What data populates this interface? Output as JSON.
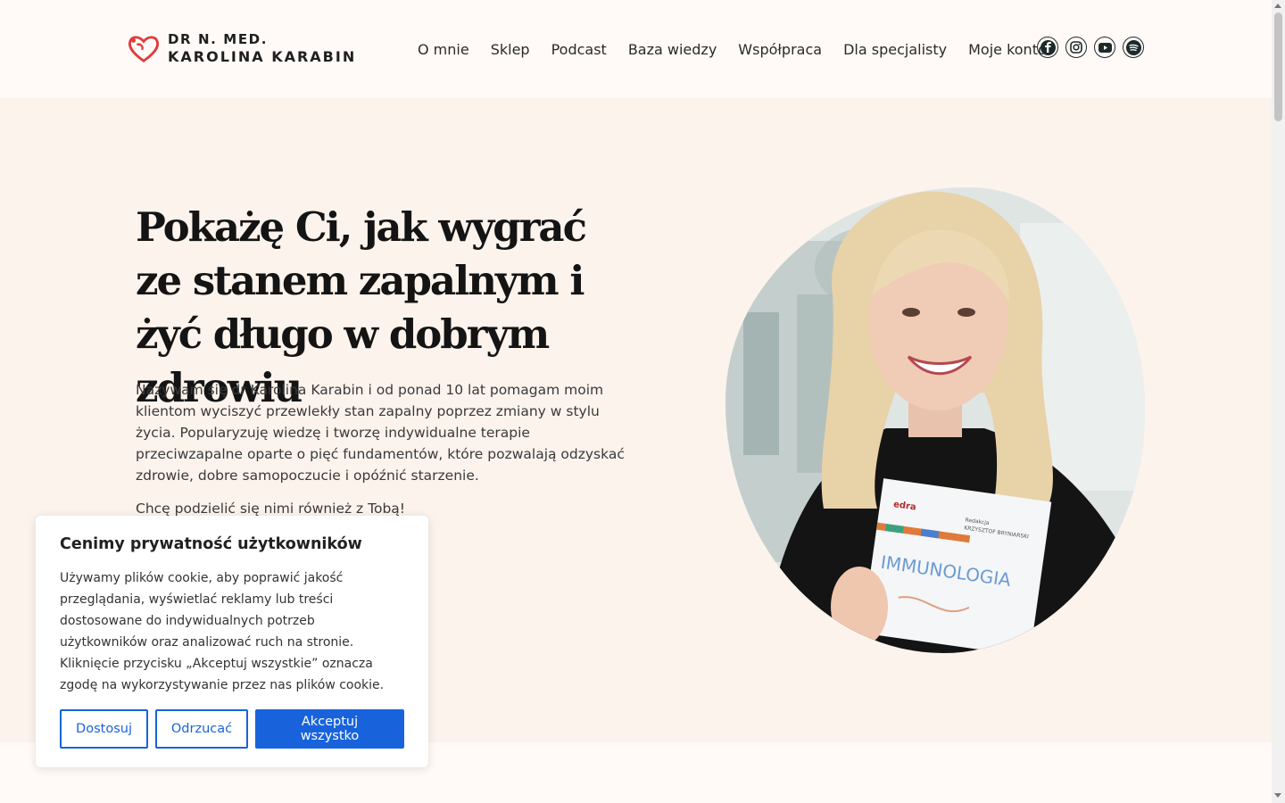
{
  "brand": {
    "line1": "DR N. MED.",
    "line2": "KAROLINA KARABIN",
    "accent_color": "#e23b3b"
  },
  "nav": {
    "items": [
      {
        "label": "O mnie"
      },
      {
        "label": "Sklep"
      },
      {
        "label": "Podcast"
      },
      {
        "label": "Baza wiedzy"
      },
      {
        "label": "Współpraca"
      },
      {
        "label": "Dla specjalisty"
      },
      {
        "label": "Moje konto"
      }
    ]
  },
  "socials": [
    {
      "icon": "facebook-icon"
    },
    {
      "icon": "instagram-icon"
    },
    {
      "icon": "youtube-icon"
    },
    {
      "icon": "spotify-icon"
    }
  ],
  "hero": {
    "title": "Pokażę Ci, jak wygrać ze stanem zapalnym i żyć długo w dobrym zdrowiu",
    "paragraph": "Nazywam się dr Karolina Karabin i od ponad 10 lat pomagam moim klientom wyciszyć przewlekły stan zapalny poprzez zmiany w stylu życia. Popularyzuję wiedzę i tworzę indywidualne terapie przeciwzapalne oparte o pięć fundamentów, które pozwalają odzyskać zdrowie, dobre samopoczucie i opóźnić starzenie.",
    "paragraph2": "Chcę podzielić się nimi również z Tobą!",
    "book_title": "IMMUNOLOGIA",
    "book_editor": "KRZYSZTOF BRYNIARSKI",
    "book_editor_label": "Redakcja"
  },
  "cookie": {
    "title": "Cenimy prywatność użytkowników",
    "text": "Używamy plików cookie, aby poprawić jakość przeglądania, wyświetlać reklamy lub treści dostosowane do indywidualnych potrzeb użytkowników oraz analizować ruch na stronie. Kliknięcie przycisku „Akceptuj wszystkie” oznacza zgodę na wykorzystywanie przez nas plików cookie.",
    "customize": "Dostosuj",
    "reject": "Odrzucać",
    "accept": "Akceptuj wszystko",
    "button_color": "#1863dc"
  }
}
